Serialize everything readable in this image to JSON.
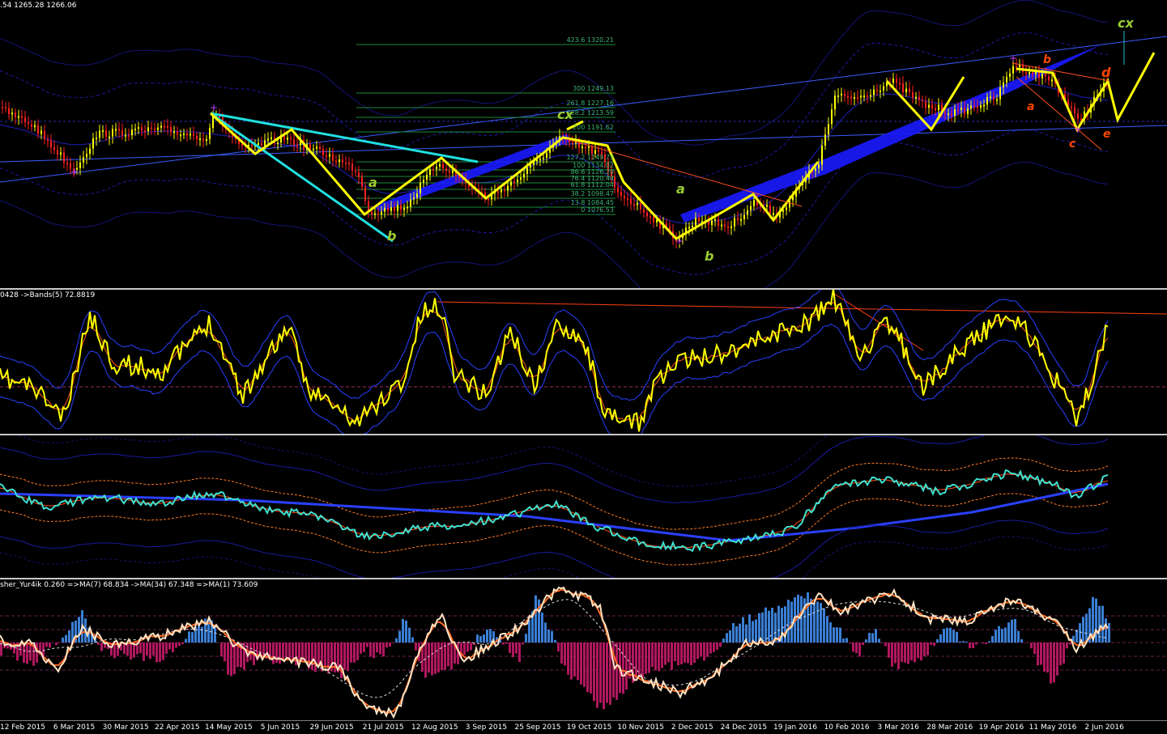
{
  "panes": {
    "main": {
      "header": ".54 1265.28 1266.06"
    },
    "osc1": {
      "header": "0428  ->Bands(5) 72.8819"
    },
    "osc2": {
      "header": ""
    },
    "osc3": {
      "header": "sher_Yur4ik 0.260  =>MA(7) 68.834  ->MA(34) 67.348  =>MA(1) 73.609"
    }
  },
  "fib_levels": [
    {
      "label": "423.6 1320.21"
    },
    {
      "label": "300 1249.13"
    },
    {
      "label": "261.8 1227.16"
    },
    {
      "label": "238.2 1213.59"
    },
    {
      "label": "200 1191.62"
    },
    {
      "label": "127.2 1149.75"
    },
    {
      "label": "100 1134.02"
    },
    {
      "label": "86.6 1126.29"
    },
    {
      "label": "76.4 1120.44"
    },
    {
      "label": "61.8 1112.04"
    },
    {
      "label": "38.2 1098.47"
    },
    {
      "label": "13.8 1084.45"
    },
    {
      "label": "0 1076.53"
    }
  ],
  "wave_labels": [
    {
      "text": "a",
      "color": "#9acd32"
    },
    {
      "text": "b",
      "color": "#9acd32"
    },
    {
      "text": "cx",
      "color": "#9acd32"
    },
    {
      "text": "a",
      "color": "#9acd32"
    },
    {
      "text": "b",
      "color": "#9acd32"
    },
    {
      "text": "b",
      "color": "#ff4500"
    },
    {
      "text": "a",
      "color": "#ff4500"
    },
    {
      "text": "c",
      "color": "#ff4500"
    },
    {
      "text": "d",
      "color": "#ff4500"
    },
    {
      "text": "e",
      "color": "#ff4500"
    },
    {
      "text": "cx",
      "color": "#9acd32"
    }
  ],
  "time_axis": [
    "12 Feb 2015",
    "6 Mar 2015",
    "30 Mar 2015",
    "22 Apr 2015",
    "14 May 2015",
    "5 Jun 2015",
    "29 Jun 2015",
    "21 Jul 2015",
    "12 Aug 2015",
    "3 Sep 2015",
    "25 Sep 2015",
    "19 Oct 2015",
    "10 Nov 2015",
    "2 Dec 2015",
    "24 Dec 2015",
    "19 Jan 2016",
    "10 Feb 2016",
    "3 Mar 2016",
    "28 Mar 2016",
    "19 Apr 2016",
    "11 May 2016",
    "2 Jun 2016"
  ],
  "colors": {
    "background": "#000000",
    "bull_candle": "#ffff00",
    "bear_candle": "#ff2020",
    "wave_arrows": "#ffff00",
    "channel": "#0000ff",
    "cyan_arrows": "#20e0e0",
    "rsi_line": "#ffff00",
    "cci_line": "#40e0d0",
    "hist_pos": "#3a7fd5",
    "hist_neg": "#b0185f",
    "fisher_line": "#ffe4c4"
  }
}
